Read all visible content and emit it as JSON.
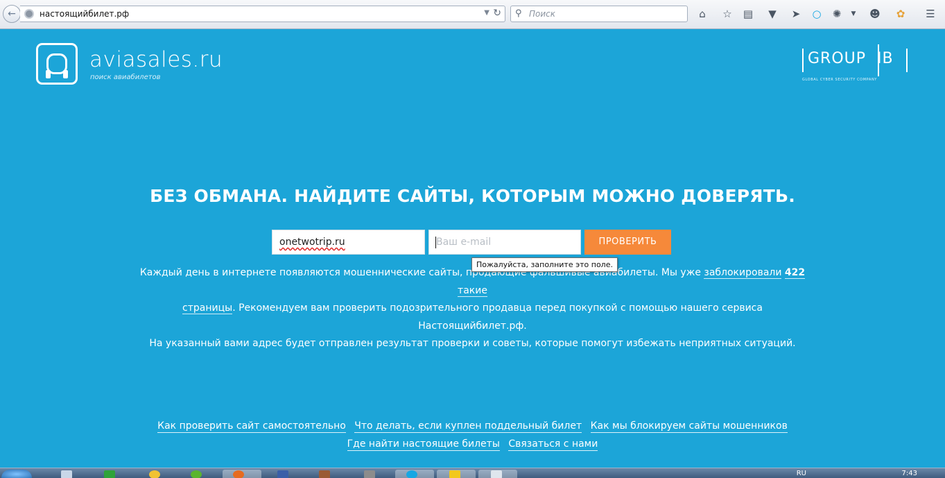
{
  "browser": {
    "url": "настоящийбилет.рф",
    "search_placeholder": "Поиск"
  },
  "header": {
    "logo_name": "aviasales.ru",
    "logo_tagline": "поиск авиабилетов",
    "partner_logo": "GROUP",
    "partner_logo_suffix": "IB",
    "partner_tagline": "GLOBAL CYBER SECURITY COMPANY"
  },
  "main": {
    "headline": "БЕЗ ОБМАНА. НАЙДИТЕ САЙТЫ, КОТОРЫМ МОЖНО ДОВЕРЯТЬ.",
    "site_value": "onetwotrip.ru",
    "email_placeholder": "Ваш e-mail",
    "check_button": "ПРОВЕРИТЬ",
    "tooltip": "Пожалуйста, заполните это поле.",
    "desc_line1_a": "Каждый день в интернете появляются мошеннические сайты, продающие фальшивые авиабилеты. Мы уже ",
    "desc_link_a": "заблокировали",
    "desc_count": "422",
    "desc_link_b": "такие",
    "desc_link_c": "страницы",
    "desc_line2": ". Рекомендуем вам проверить подозрительного продавца перед покупкой с помощью нашего сервиса Настоящийбилет.рф.",
    "desc_line3": "На указанный вами адрес будет отправлен результат проверки и советы, которые помогут избежать неприятных ситуаций."
  },
  "footer": {
    "links_row1": [
      "Как проверить сайт самостоятельно",
      "Что делать, если куплен поддельный билет",
      "Как мы блокируем сайты мошенников"
    ],
    "links_row2": [
      "Где найти настоящие билеты",
      "Связаться с нами"
    ]
  },
  "taskbar": {
    "clock": "7:43",
    "lang": "RU"
  },
  "colors": {
    "page_background": "#1ca5d8",
    "button": "#f6893a"
  }
}
